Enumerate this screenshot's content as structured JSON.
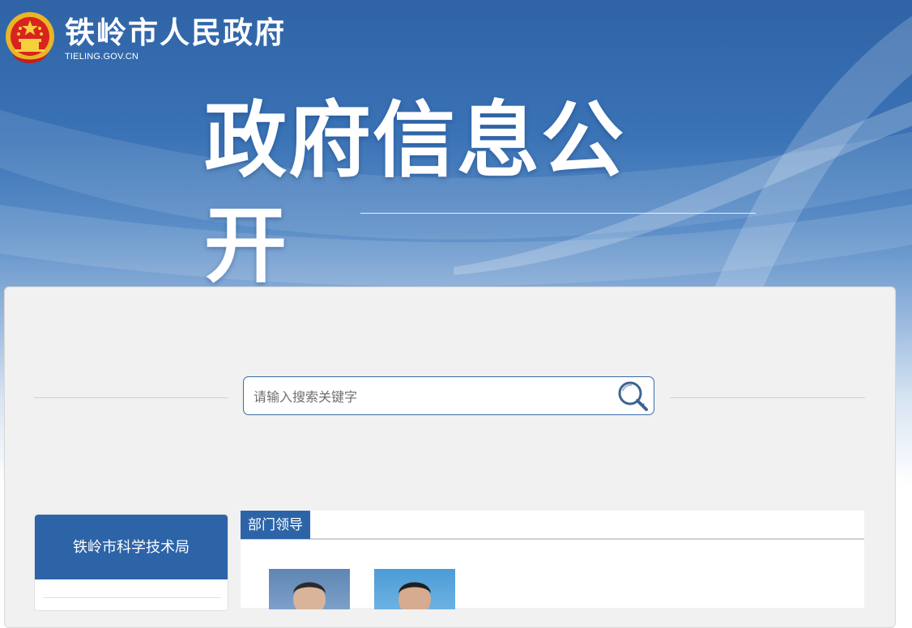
{
  "header": {
    "site_title": "铁岭市人民政府",
    "site_domain": "TIELING.GOV.CN"
  },
  "hero": {
    "title": "政府信息公开"
  },
  "search": {
    "placeholder": "请输入搜索关键字",
    "value": ""
  },
  "sidebar": {
    "department_name": "铁岭市科学技术局"
  },
  "section": {
    "tab_label": "部门领导"
  },
  "colors": {
    "brand_blue": "#2d64a8",
    "search_border": "#3a6aa3",
    "panel_bg": "#f1f1f1"
  },
  "icons": {
    "emblem": "national-emblem-icon",
    "search": "search-icon"
  }
}
